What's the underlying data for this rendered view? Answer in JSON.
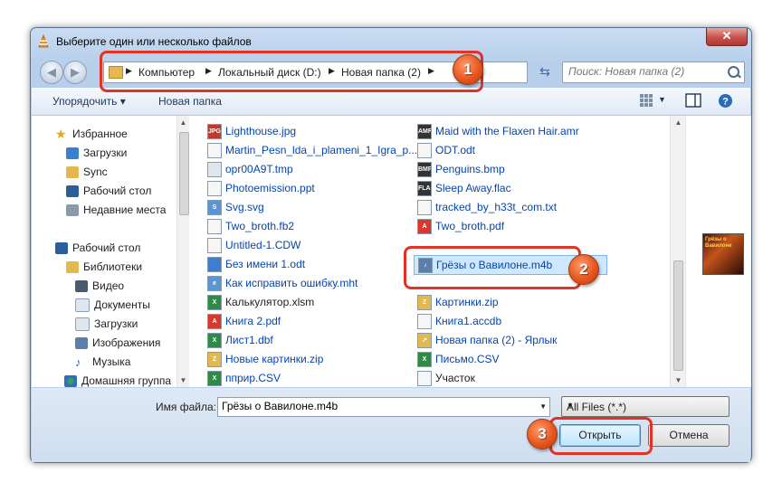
{
  "window": {
    "title": "Выберите один или несколько файлов",
    "close_label": "✕"
  },
  "nav": {
    "back_label": "◀",
    "forward_label": "▶",
    "breadcrumb": [
      "Компьютер",
      "Локальный диск (D:)",
      "Новая папка (2)"
    ],
    "search_placeholder": "Поиск: Новая папка (2)"
  },
  "toolbar": {
    "organize": "Упорядочить ▾",
    "new_folder": "Новая папка"
  },
  "sidebar": {
    "items": [
      {
        "label": "Избранное",
        "icon": "star-icon"
      },
      {
        "label": "Загрузки",
        "icon": "downloads-folder-icon"
      },
      {
        "label": "Sync",
        "icon": "folder-icon"
      },
      {
        "label": "Рабочий стол",
        "icon": "desktop-icon"
      },
      {
        "label": "Недавние места",
        "icon": "recent-places-icon"
      },
      {
        "label": "Рабочий стол",
        "icon": "desktop-icon"
      },
      {
        "label": "Библиотеки",
        "icon": "libraries-icon"
      },
      {
        "label": "Видео",
        "icon": "video-library-icon"
      },
      {
        "label": "Документы",
        "icon": "documents-library-icon"
      },
      {
        "label": "Загрузки",
        "icon": "downloads-library-icon"
      },
      {
        "label": "Изображения",
        "icon": "pictures-library-icon"
      },
      {
        "label": "Музыка",
        "icon": "music-library-icon"
      },
      {
        "label": "Домашняя группа",
        "icon": "homegroup-icon"
      }
    ]
  },
  "files": {
    "col1": [
      "Lighthouse.jpg",
      "Martin_Pesn_lda_i_plameni_1_Igra_p...",
      "opr00A9T.tmp",
      "Photoemission.ppt",
      "Svg.svg",
      "Two_broth.fb2",
      "Untitled-1.CDW",
      "Без имени 1.odt",
      "Как исправить ошибку.mht",
      "Калькулятор.xlsm",
      "Книга 2.pdf",
      "Лист1.dbf",
      "Новые картинки.zip",
      "пприр.CSV"
    ],
    "col2": [
      "Maid with the Flaxen Hair.amr",
      "ODT.odt",
      "Penguins.bmp",
      "Sleep Away.flac",
      "tracked_by_h33t_com.txt",
      "Two_broth.pdf",
      "Грёзы о Вавилоне.m4b",
      "Картинки.zip",
      "Книга1.accdb",
      "Новая папка (2) - Ярлык",
      "Письмо.CSV",
      "Участок"
    ]
  },
  "preview": {
    "thumbnail_text": "Грёзы о Вавилоне"
  },
  "bottom": {
    "filename_label": "Имя файла:",
    "filename_value": "Грёзы о Вавилоне.m4b",
    "filter_value": "All Files (*.*)",
    "open_label": "Открыть",
    "cancel_label": "Отмена"
  },
  "callouts": {
    "one": "1",
    "two": "2",
    "three": "3"
  },
  "colors": {
    "callout_red": "#e23327",
    "badge_orange": "#e8561e",
    "link_blue": "#0645ad"
  }
}
